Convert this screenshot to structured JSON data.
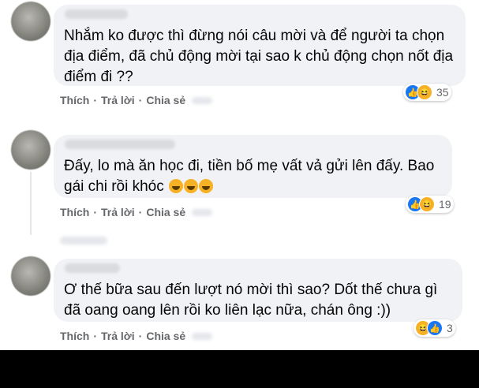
{
  "comments": [
    {
      "lines": [
        "Nhắm ko được thì đừng nói câu mời và để người ta chọn",
        "địa điểm, đã chủ động mời tại sao k chủ động chọn nốt địa",
        "điểm đi ??"
      ],
      "actions": {
        "like": "Thích",
        "reply": "Trả lời",
        "share": "Chia sẻ"
      },
      "reaction_count": "35"
    },
    {
      "lines": [
        "Đấy, lo mà ăn học đi, tiền bố mẹ vất vả gửi lên đấy. Bao",
        "gái chi rồi khóc"
      ],
      "actions": {
        "like": "Thích",
        "reply": "Trả lời",
        "share": "Chia sẻ"
      },
      "reaction_count": "19"
    },
    {
      "lines": [
        "Ơ thế bữa sau đến lượt nó mời thì sao? Dốt thế chưa gì",
        "đã oang oang lên rồi ko liên lạc nữa, chán ông :))"
      ],
      "actions": {
        "like": "Thích",
        "reply": "Trả lời",
        "share": "Chia sẻ"
      },
      "reaction_count": "3"
    }
  ],
  "separator": "·"
}
